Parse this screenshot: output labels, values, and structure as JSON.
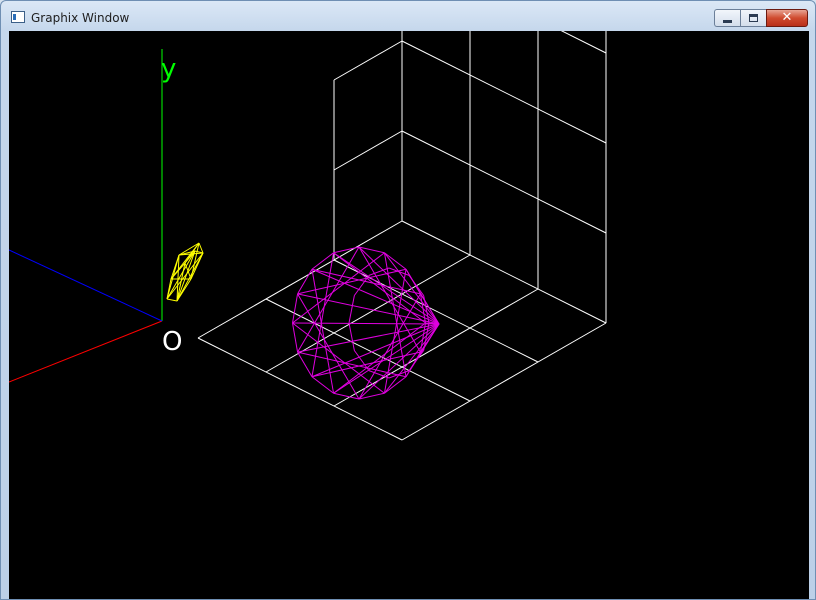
{
  "window": {
    "title": "Graphix Window",
    "icon": "app-window-icon",
    "buttons": {
      "minimize_icon": "minimize-icon",
      "maximize_icon": "maximize-icon",
      "close_icon": "close-icon",
      "close_glyph": "✕"
    }
  },
  "scene": {
    "background": "#000000",
    "axes": {
      "y_label": "y",
      "origin_label": "O",
      "x_color": "#ff0000",
      "y_color": "#00ff00",
      "z_color": "#0000ff"
    },
    "colors": {
      "grid": "#ffffff",
      "sphere": "#e000e0",
      "small_solid": "#ffff00"
    }
  }
}
